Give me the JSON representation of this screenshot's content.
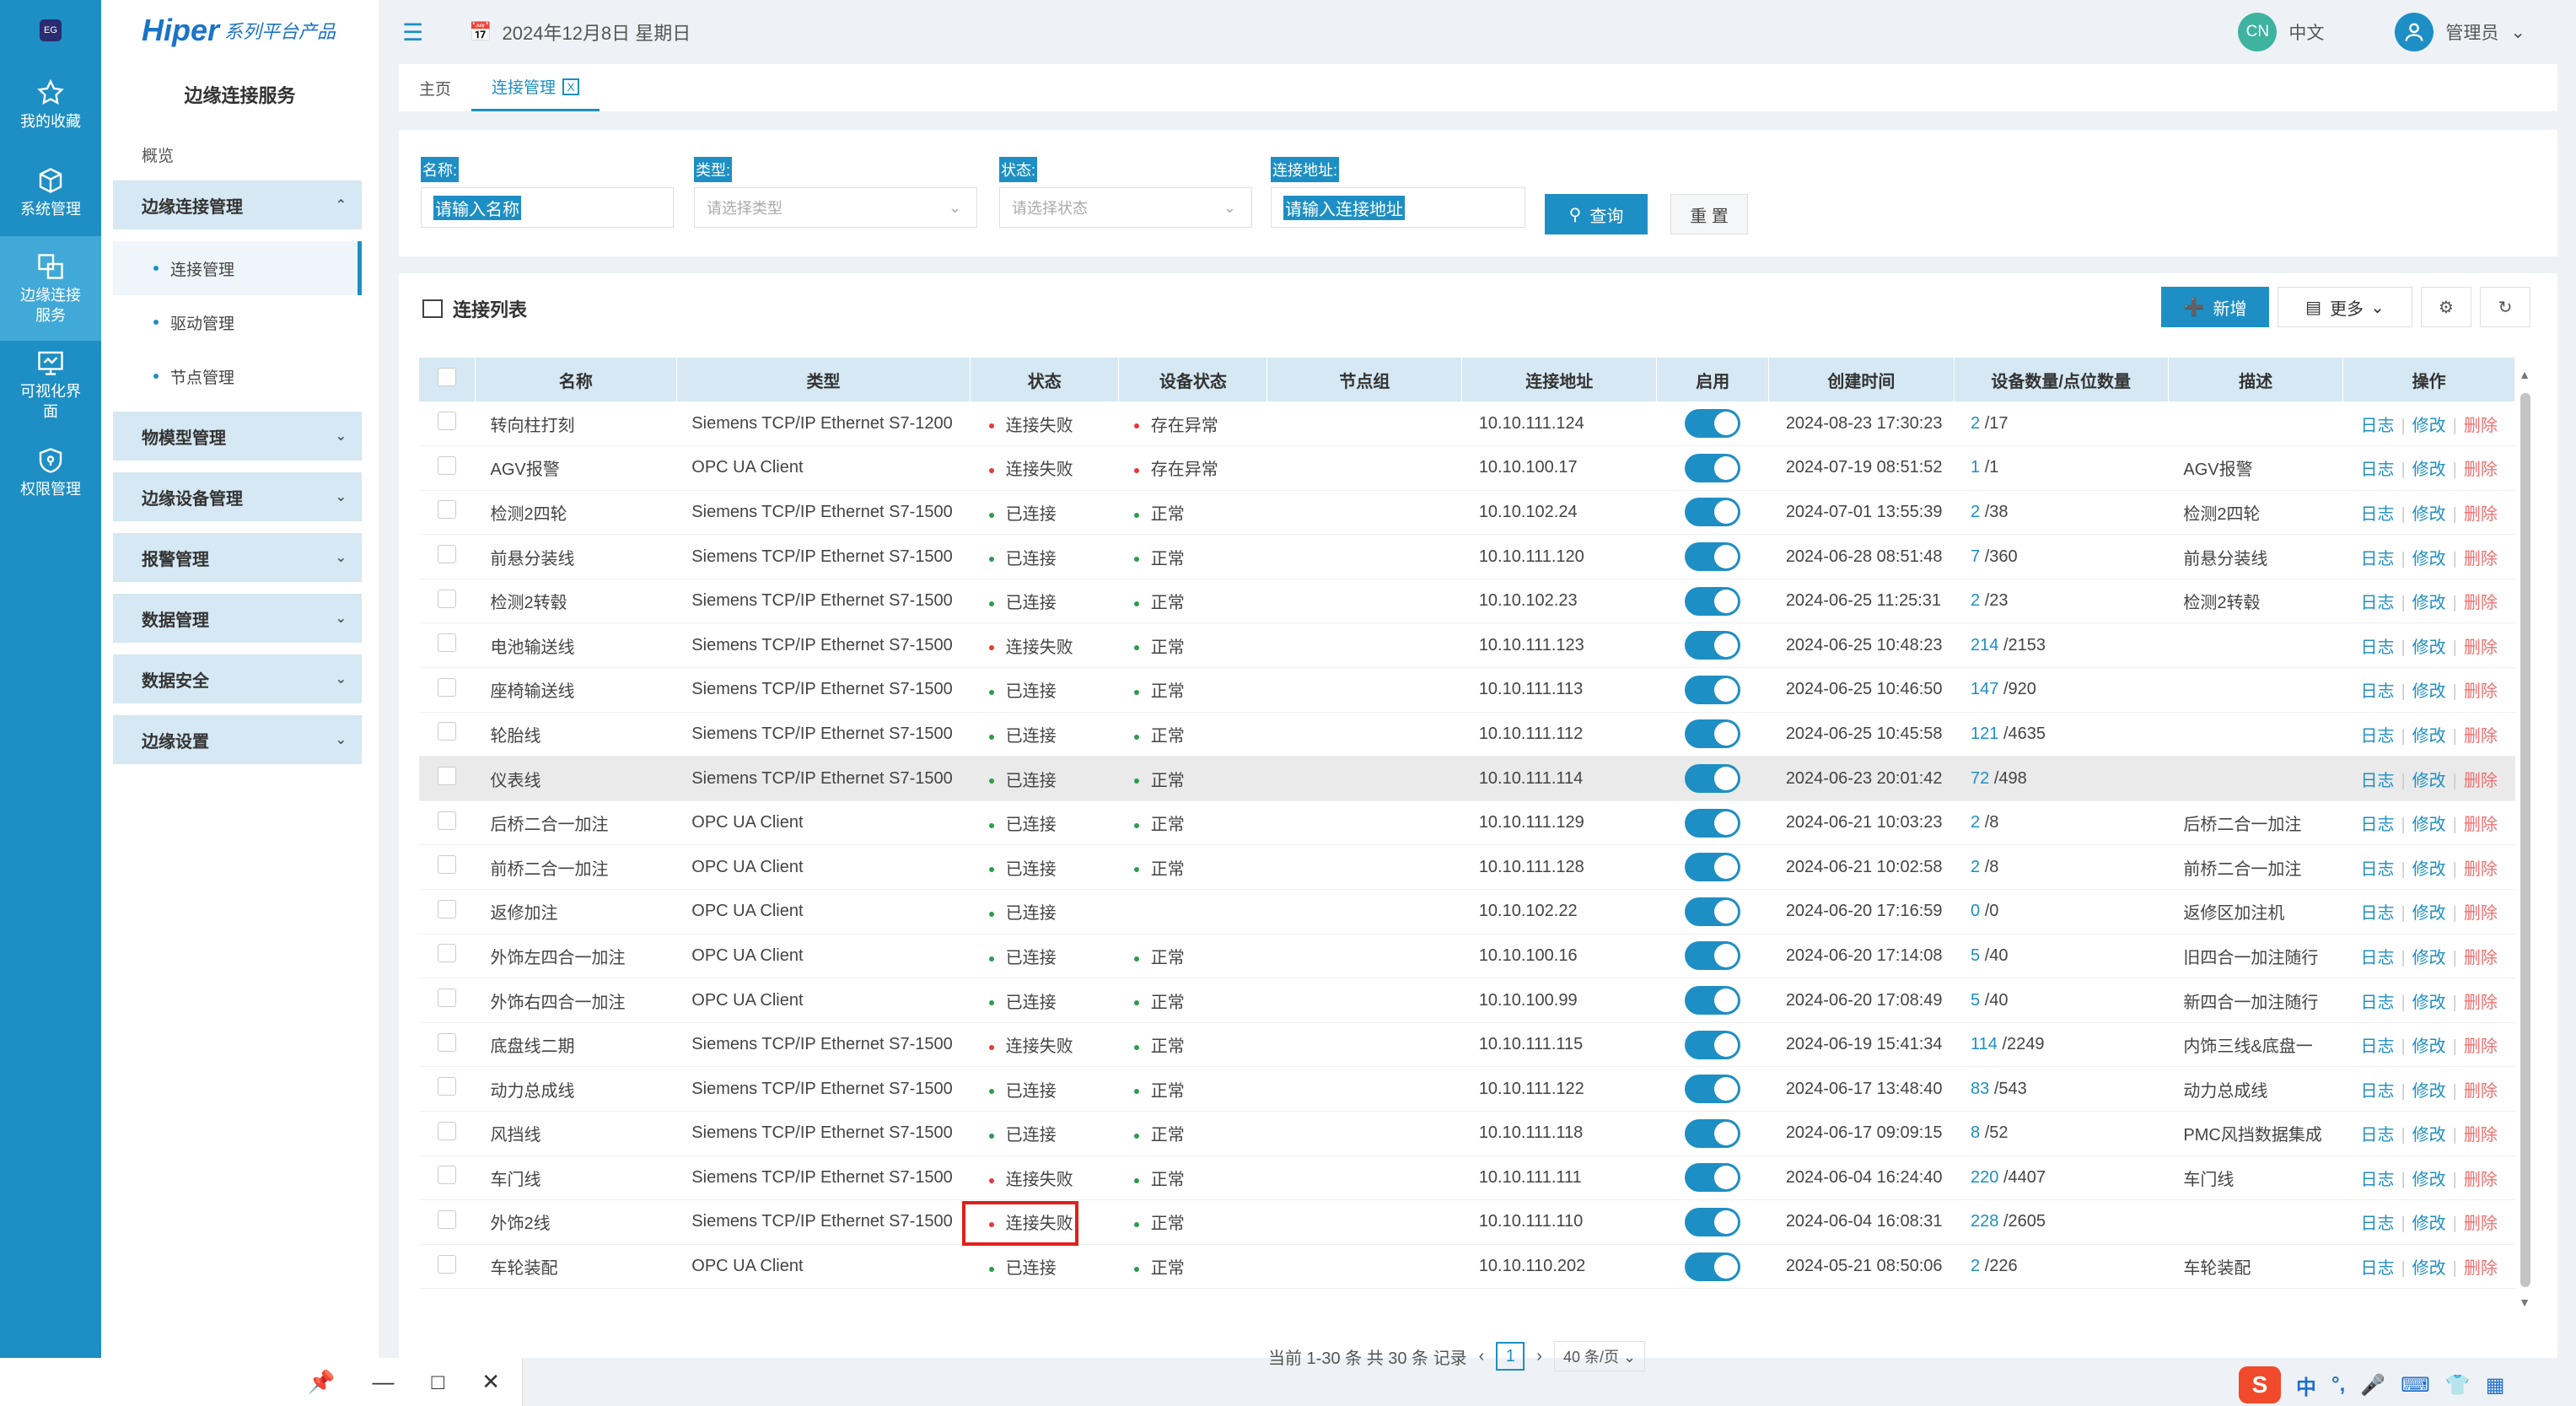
{
  "rail": {
    "logo": "EG",
    "items": [
      {
        "label": "我的收藏"
      },
      {
        "label": "系统管理"
      },
      {
        "label": "边缘连接服务"
      },
      {
        "label": "可视化界面"
      },
      {
        "label": "权限管理"
      }
    ]
  },
  "sidebar": {
    "brand": "Hiper",
    "brand_sub": "系列平台产品",
    "title": "边缘连接服务",
    "overview": "概览",
    "groups": [
      {
        "label": "边缘连接管理",
        "children": [
          "连接管理",
          "驱动管理",
          "节点管理"
        ]
      },
      {
        "label": "物模型管理"
      },
      {
        "label": "边缘设备管理"
      },
      {
        "label": "报警管理"
      },
      {
        "label": "数据管理"
      },
      {
        "label": "数据安全"
      },
      {
        "label": "边缘设置"
      }
    ]
  },
  "header": {
    "date": "2024年12月8日 星期日",
    "lang_badge": "CN",
    "lang": "中文",
    "user": "管理员"
  },
  "tabs": [
    {
      "label": "主页"
    },
    {
      "label": "连接管理",
      "close": "X"
    }
  ],
  "filter": {
    "name_label": "名称:",
    "name_placeholder": "请输入名称",
    "type_label": "类型:",
    "type_placeholder": "请选择类型",
    "status_label": "状态:",
    "status_placeholder": "请选择状态",
    "addr_label": "连接地址:",
    "addr_placeholder": "请输入连接地址",
    "query": "查询",
    "reset": "重 置"
  },
  "list": {
    "title": "连接列表",
    "add": "新增",
    "more": "更多",
    "columns": [
      "名称",
      "类型",
      "状态",
      "设备状态",
      "节点组",
      "连接地址",
      "启用",
      "创建时间",
      "设备数量/点位数量",
      "描述",
      "操作"
    ],
    "ops": {
      "log": "日志",
      "edit": "修改",
      "del": "删除"
    },
    "rows": [
      {
        "name": "转向柱打刻",
        "type": "Siemens TCP/IP Ethernet S7-1200",
        "status": "连接失败",
        "status_color": "#e5383b",
        "dev": "存在异常",
        "dev_color": "#e5383b",
        "addr": "10.10.111.124",
        "time": "2024-08-23 17:30:23",
        "dcount": "2",
        "pcount": "/17",
        "desc": ""
      },
      {
        "name": "AGV报警",
        "type": "OPC UA Client",
        "status": "连接失败",
        "status_color": "#e5383b",
        "dev": "存在异常",
        "dev_color": "#e5383b",
        "addr": "10.10.100.17",
        "time": "2024-07-19 08:51:52",
        "dcount": "1",
        "pcount": "/1",
        "desc": "AGV报警"
      },
      {
        "name": "检测2四轮",
        "type": "Siemens TCP/IP Ethernet S7-1500",
        "status": "已连接",
        "status_color": "#2c9c4c",
        "dev": "正常",
        "dev_color": "#2c9c4c",
        "addr": "10.10.102.24",
        "time": "2024-07-01 13:55:39",
        "dcount": "2",
        "pcount": "/38",
        "desc": "检测2四轮"
      },
      {
        "name": "前悬分装线",
        "type": "Siemens TCP/IP Ethernet S7-1500",
        "status": "已连接",
        "status_color": "#2c9c4c",
        "dev": "正常",
        "dev_color": "#2c9c4c",
        "addr": "10.10.111.120",
        "time": "2024-06-28 08:51:48",
        "dcount": "7",
        "pcount": "/360",
        "desc": "前悬分装线"
      },
      {
        "name": "检测2转毂",
        "type": "Siemens TCP/IP Ethernet S7-1500",
        "status": "已连接",
        "status_color": "#2c9c4c",
        "dev": "正常",
        "dev_color": "#2c9c4c",
        "addr": "10.10.102.23",
        "time": "2024-06-25 11:25:31",
        "dcount": "2",
        "pcount": "/23",
        "desc": "检测2转毂"
      },
      {
        "name": "电池输送线",
        "type": "Siemens TCP/IP Ethernet S7-1500",
        "status": "连接失败",
        "status_color": "#e5383b",
        "dev": "正常",
        "dev_color": "#2c9c4c",
        "addr": "10.10.111.123",
        "time": "2024-06-25 10:48:23",
        "dcount": "214",
        "pcount": "/2153",
        "desc": ""
      },
      {
        "name": "座椅输送线",
        "type": "Siemens TCP/IP Ethernet S7-1500",
        "status": "已连接",
        "status_color": "#2c9c4c",
        "dev": "正常",
        "dev_color": "#2c9c4c",
        "addr": "10.10.111.113",
        "time": "2024-06-25 10:46:50",
        "dcount": "147",
        "pcount": "/920",
        "desc": ""
      },
      {
        "name": "轮胎线",
        "type": "Siemens TCP/IP Ethernet S7-1500",
        "status": "已连接",
        "status_color": "#2c9c4c",
        "dev": "正常",
        "dev_color": "#2c9c4c",
        "addr": "10.10.111.112",
        "time": "2024-06-25 10:45:58",
        "dcount": "121",
        "pcount": "/4635",
        "desc": ""
      },
      {
        "name": "仪表线",
        "type": "Siemens TCP/IP Ethernet S7-1500",
        "status": "已连接",
        "status_color": "#2c9c4c",
        "dev": "正常",
        "dev_color": "#2c9c4c",
        "addr": "10.10.111.114",
        "time": "2024-06-23 20:01:42",
        "dcount": "72",
        "pcount": "/498",
        "desc": "",
        "highlight": true
      },
      {
        "name": "后桥二合一加注",
        "type": "OPC UA Client",
        "status": "已连接",
        "status_color": "#2c9c4c",
        "dev": "正常",
        "dev_color": "#2c9c4c",
        "addr": "10.10.111.129",
        "time": "2024-06-21 10:03:23",
        "dcount": "2",
        "pcount": "/8",
        "desc": "后桥二合一加注"
      },
      {
        "name": "前桥二合一加注",
        "type": "OPC UA Client",
        "status": "已连接",
        "status_color": "#2c9c4c",
        "dev": "正常",
        "dev_color": "#2c9c4c",
        "addr": "10.10.111.128",
        "time": "2024-06-21 10:02:58",
        "dcount": "2",
        "pcount": "/8",
        "desc": "前桥二合一加注"
      },
      {
        "name": "返修加注",
        "type": "OPC UA Client",
        "status": "已连接",
        "status_color": "#2c9c4c",
        "dev": "",
        "dev_color": "",
        "addr": "10.10.102.22",
        "time": "2024-06-20 17:16:59",
        "dcount": "0",
        "pcount": "/0",
        "desc": "返修区加注机"
      },
      {
        "name": "外饰左四合一加注",
        "type": "OPC UA Client",
        "status": "已连接",
        "status_color": "#2c9c4c",
        "dev": "正常",
        "dev_color": "#2c9c4c",
        "addr": "10.10.100.16",
        "time": "2024-06-20 17:14:08",
        "dcount": "5",
        "pcount": "/40",
        "desc": "旧四合一加注随行"
      },
      {
        "name": "外饰右四合一加注",
        "type": "OPC UA Client",
        "status": "已连接",
        "status_color": "#2c9c4c",
        "dev": "正常",
        "dev_color": "#2c9c4c",
        "addr": "10.10.100.99",
        "time": "2024-06-20 17:08:49",
        "dcount": "5",
        "pcount": "/40",
        "desc": "新四合一加注随行"
      },
      {
        "name": "底盘线二期",
        "type": "Siemens TCP/IP Ethernet S7-1500",
        "status": "连接失败",
        "status_color": "#e5383b",
        "dev": "正常",
        "dev_color": "#2c9c4c",
        "addr": "10.10.111.115",
        "time": "2024-06-19 15:41:34",
        "dcount": "114",
        "pcount": "/2249",
        "desc": "内饰三线&底盘一"
      },
      {
        "name": "动力总成线",
        "type": "Siemens TCP/IP Ethernet S7-1500",
        "status": "已连接",
        "status_color": "#2c9c4c",
        "dev": "正常",
        "dev_color": "#2c9c4c",
        "addr": "10.10.111.122",
        "time": "2024-06-17 13:48:40",
        "dcount": "83",
        "pcount": "/543",
        "desc": "动力总成线"
      },
      {
        "name": "风挡线",
        "type": "Siemens TCP/IP Ethernet S7-1500",
        "status": "已连接",
        "status_color": "#2c9c4c",
        "dev": "正常",
        "dev_color": "#2c9c4c",
        "addr": "10.10.111.118",
        "time": "2024-06-17 09:09:15",
        "dcount": "8",
        "pcount": "/52",
        "desc": "PMC风挡数据集成"
      },
      {
        "name": "车门线",
        "type": "Siemens TCP/IP Ethernet S7-1500",
        "status": "连接失败",
        "status_color": "#e5383b",
        "dev": "正常",
        "dev_color": "#2c9c4c",
        "addr": "10.10.111.111",
        "time": "2024-06-04 16:24:40",
        "dcount": "220",
        "pcount": "/4407",
        "desc": "车门线"
      },
      {
        "name": "外饰2线",
        "type": "Siemens TCP/IP Ethernet S7-1500",
        "status": "连接失败",
        "status_color": "#e5383b",
        "dev": "正常",
        "dev_color": "#2c9c4c",
        "addr": "10.10.111.110",
        "time": "2024-06-04 16:08:31",
        "dcount": "228",
        "pcount": "/2605",
        "desc": ""
      },
      {
        "name": "车轮装配",
        "type": "OPC UA Client",
        "status": "已连接",
        "status_color": "#2c9c4c",
        "dev": "正常",
        "dev_color": "#2c9c4c",
        "addr": "10.10.110.202",
        "time": "2024-05-21 08:50:06",
        "dcount": "2",
        "pcount": "/226",
        "desc": "车轮装配"
      }
    ]
  },
  "pager": {
    "summary": "当前 1-30 条 共 30 条 记录",
    "page": "1",
    "size": "40 条/页"
  },
  "ime": {
    "lang": "中"
  },
  "colors": {
    "accent": "#1e8fc4",
    "rail": "#1e8fc4",
    "error": "#e5383b",
    "ok": "#2c9c4c"
  }
}
